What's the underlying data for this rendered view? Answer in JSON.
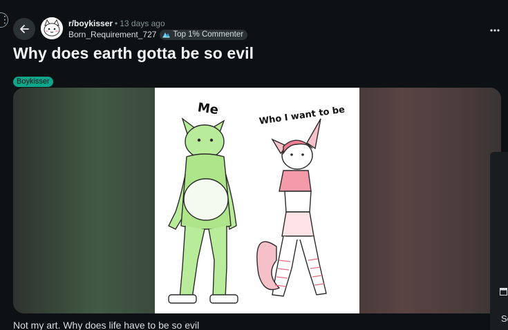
{
  "post": {
    "subreddit": "r/boykisser",
    "separator": "•",
    "time_ago": "13 days ago",
    "author": "Born_Requirement_727",
    "author_badge": "Top 1% Commenter",
    "title": "Why does earth gotta be so evil",
    "flair": "Boykisser",
    "flair_color": "#0fa58b",
    "caption": "Not my art. Why does life have to be so evil"
  },
  "image": {
    "label_left": "Me",
    "label_right": "Who I want to be"
  },
  "icons": {
    "back": "arrow-left-icon",
    "more": "more-horizontal-icon",
    "badge": "achievement-icon"
  },
  "side_panel": {
    "text": "So"
  },
  "colors": {
    "background": "#0e1113",
    "button_bg": "#2a3236",
    "muted_text": "#82959b"
  }
}
